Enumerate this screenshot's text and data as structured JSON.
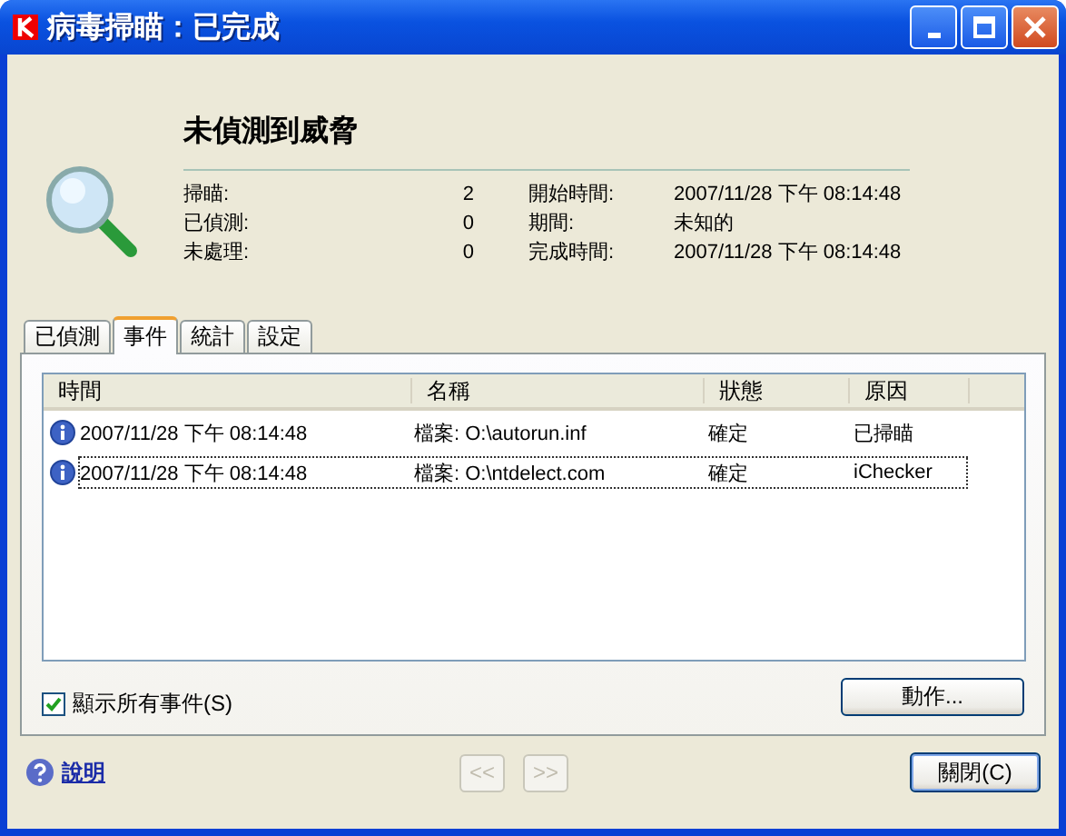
{
  "window": {
    "title": "病毒掃瞄：已完成"
  },
  "summary": {
    "heading": "未偵測到威脅",
    "stats": [
      {
        "label": "掃瞄:",
        "value": "2",
        "label_2": "開始時間:",
        "value_2": "2007/11/28 下午 08:14:48"
      },
      {
        "label": "已偵測:",
        "value": "0",
        "label_2": "期間:",
        "value_2": "未知的"
      },
      {
        "label": "未處理:",
        "value": "0",
        "label_2": "完成時間:",
        "value_2": "2007/11/28 下午 08:14:48"
      }
    ]
  },
  "tabs": [
    {
      "label": "已偵測",
      "selected": false
    },
    {
      "label": "事件",
      "selected": true
    },
    {
      "label": "統計",
      "selected": false
    },
    {
      "label": "設定",
      "selected": false
    }
  ],
  "table": {
    "columns": [
      "時間",
      "名稱",
      "狀態",
      "原因"
    ],
    "rows": [
      {
        "cells": [
          "2007/11/28 下午 08:14:48",
          "檔案: O:\\autorun.inf",
          "確定",
          "已掃瞄"
        ],
        "focused": false
      },
      {
        "cells": [
          "2007/11/28 下午 08:14:48",
          "檔案: O:\\ntdelect.com",
          "確定",
          "iChecker"
        ],
        "focused": true
      }
    ]
  },
  "show_all_checkbox": {
    "label": "顯示所有事件(S)",
    "checked": true
  },
  "action_button": "動作...",
  "help_link": "說明",
  "nav_buttons": [
    {
      "label": "<<",
      "disabled": true
    },
    {
      "label": ">>",
      "disabled": true
    }
  ],
  "close_button": "關閉(C)"
}
